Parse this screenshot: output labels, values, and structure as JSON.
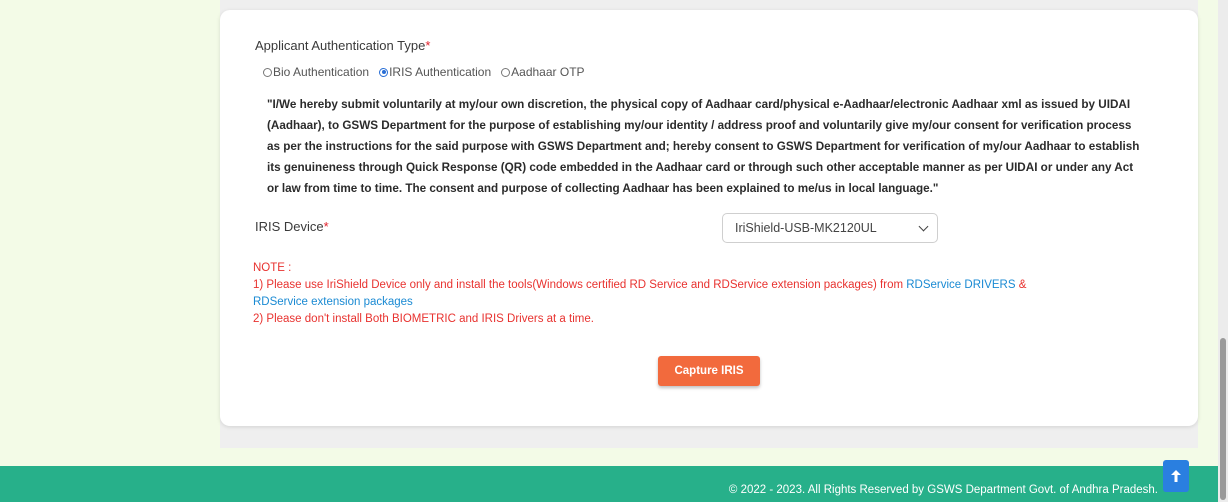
{
  "auth": {
    "label": "Applicant Authentication Type",
    "required_mark": "*",
    "options": [
      {
        "label": "Bio Authentication",
        "selected": false
      },
      {
        "label": "IRIS Authentication",
        "selected": true
      },
      {
        "label": "Aadhaar OTP",
        "selected": false
      }
    ]
  },
  "consent_text": "\"I/We hereby submit voluntarily at my/our own discretion, the physical copy of Aadhaar card/physical e-Aadhaar/electronic Aadhaar xml as issued by UIDAI (Aadhaar), to GSWS Department for the purpose of establishing my/our identity / address proof and voluntarily give my/our consent for verification process as per the instructions for the said purpose with GSWS Department and; hereby consent to GSWS Department for verification of my/our Aadhaar to establish its genuineness through Quick Response (QR) code embedded in the Aadhaar card or through such other acceptable manner as per UIDAI or under any Act or law from time to time. The consent and purpose of collecting Aadhaar has been explained to me/us in local language.\"",
  "iris_device": {
    "label": "IRIS Device",
    "required_mark": "*",
    "selected_value": "IriShield-USB-MK2120UL"
  },
  "note": {
    "title": "NOTE :",
    "line1_prefix": "1) Please use IriShield Device only and install the tools(Windows certified RD Service and RDService extension packages) from ",
    "link1": "RDService DRIVERS",
    "amp": " & ",
    "link2": "RDService extension packages",
    "line2": "2) Please don't install Both BIOMETRIC and IRIS Drivers at a time."
  },
  "capture_button": "Capture IRIS",
  "footer": {
    "text": "© 2022 - 2023. All Rights Reserved by GSWS Department Govt. of Andhra Pradesh."
  },
  "colors": {
    "accent_button": "#f26a3d",
    "footer_bg": "#27b08a",
    "note_text": "#e8322f",
    "link": "#1a8ad3",
    "page_bg": "#f3fbe7"
  },
  "icons": {
    "scroll_top": "arrow-up-icon",
    "select_chevron": "chevron-down-icon"
  }
}
